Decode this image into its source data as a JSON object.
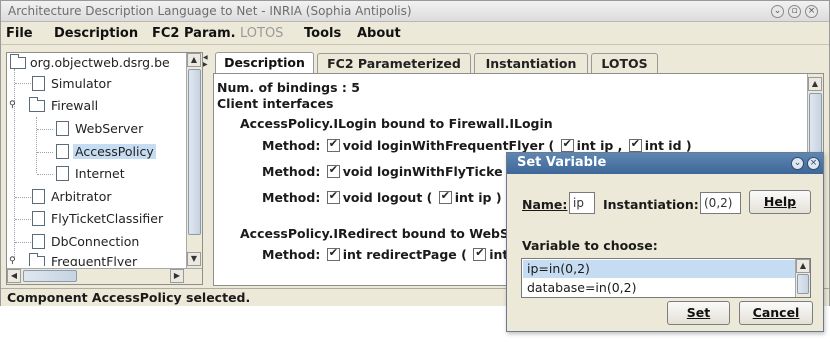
{
  "window": {
    "title": "Architecture Description Language to Net  -  INRIA (Sophia Antipolis)"
  },
  "menu": [
    {
      "label": "File"
    },
    {
      "label": "Description"
    },
    {
      "label": "FC2 Param."
    },
    {
      "label": "LOTOS"
    },
    {
      "label": "Tools"
    },
    {
      "label": "About"
    }
  ],
  "tree": {
    "root": "org.objectweb.dsrg.be",
    "items": [
      {
        "label": "Simulator"
      },
      {
        "label": "Firewall"
      },
      {
        "label": "WebServer"
      },
      {
        "label": "AccessPolicy",
        "selected": true
      },
      {
        "label": "Internet"
      },
      {
        "label": "Arbitrator"
      },
      {
        "label": "FlyTicketClassifier"
      },
      {
        "label": "DbConnection"
      },
      {
        "label": "FrequentFlyer"
      }
    ]
  },
  "tabs": [
    {
      "label": "Description",
      "active": true
    },
    {
      "label": "FC2 Parameterized"
    },
    {
      "label": "Instantiation"
    },
    {
      "label": "LOTOS"
    }
  ],
  "content": {
    "bindings_label": "Num. of bindings :",
    "bindings_count": "5",
    "client_interfaces": "Client interfaces",
    "binding1": "AccessPolicy.ILogin bound to Firewall.ILogin",
    "method_label": "Method:",
    "m1_sig": "void loginWithFrequentFlyer (",
    "m1_p1": "int ip ,",
    "m1_p2": "int id )",
    "m2_sig": "void loginWithFlyTicke",
    "m3_sig": "void logout (",
    "m3_p1": "int ip )",
    "binding2": "AccessPolicy.IRedirect bound to WebSe",
    "m4_sig": "int redirectPage (",
    "m4_p1": "int"
  },
  "status": "Component AccessPolicy selected.",
  "dialog": {
    "title": "Set Variable",
    "name_label": "Name:",
    "name_value": "ip",
    "instantiation_label": "Instantiation:",
    "instantiation_value": "(0,2)",
    "help_button": "Help",
    "variable_label": "Variable to choose:",
    "variables": [
      "ip=in(0,2)",
      "database=in(0,2)"
    ],
    "set_button": "Set",
    "cancel_button": "Cancel"
  }
}
